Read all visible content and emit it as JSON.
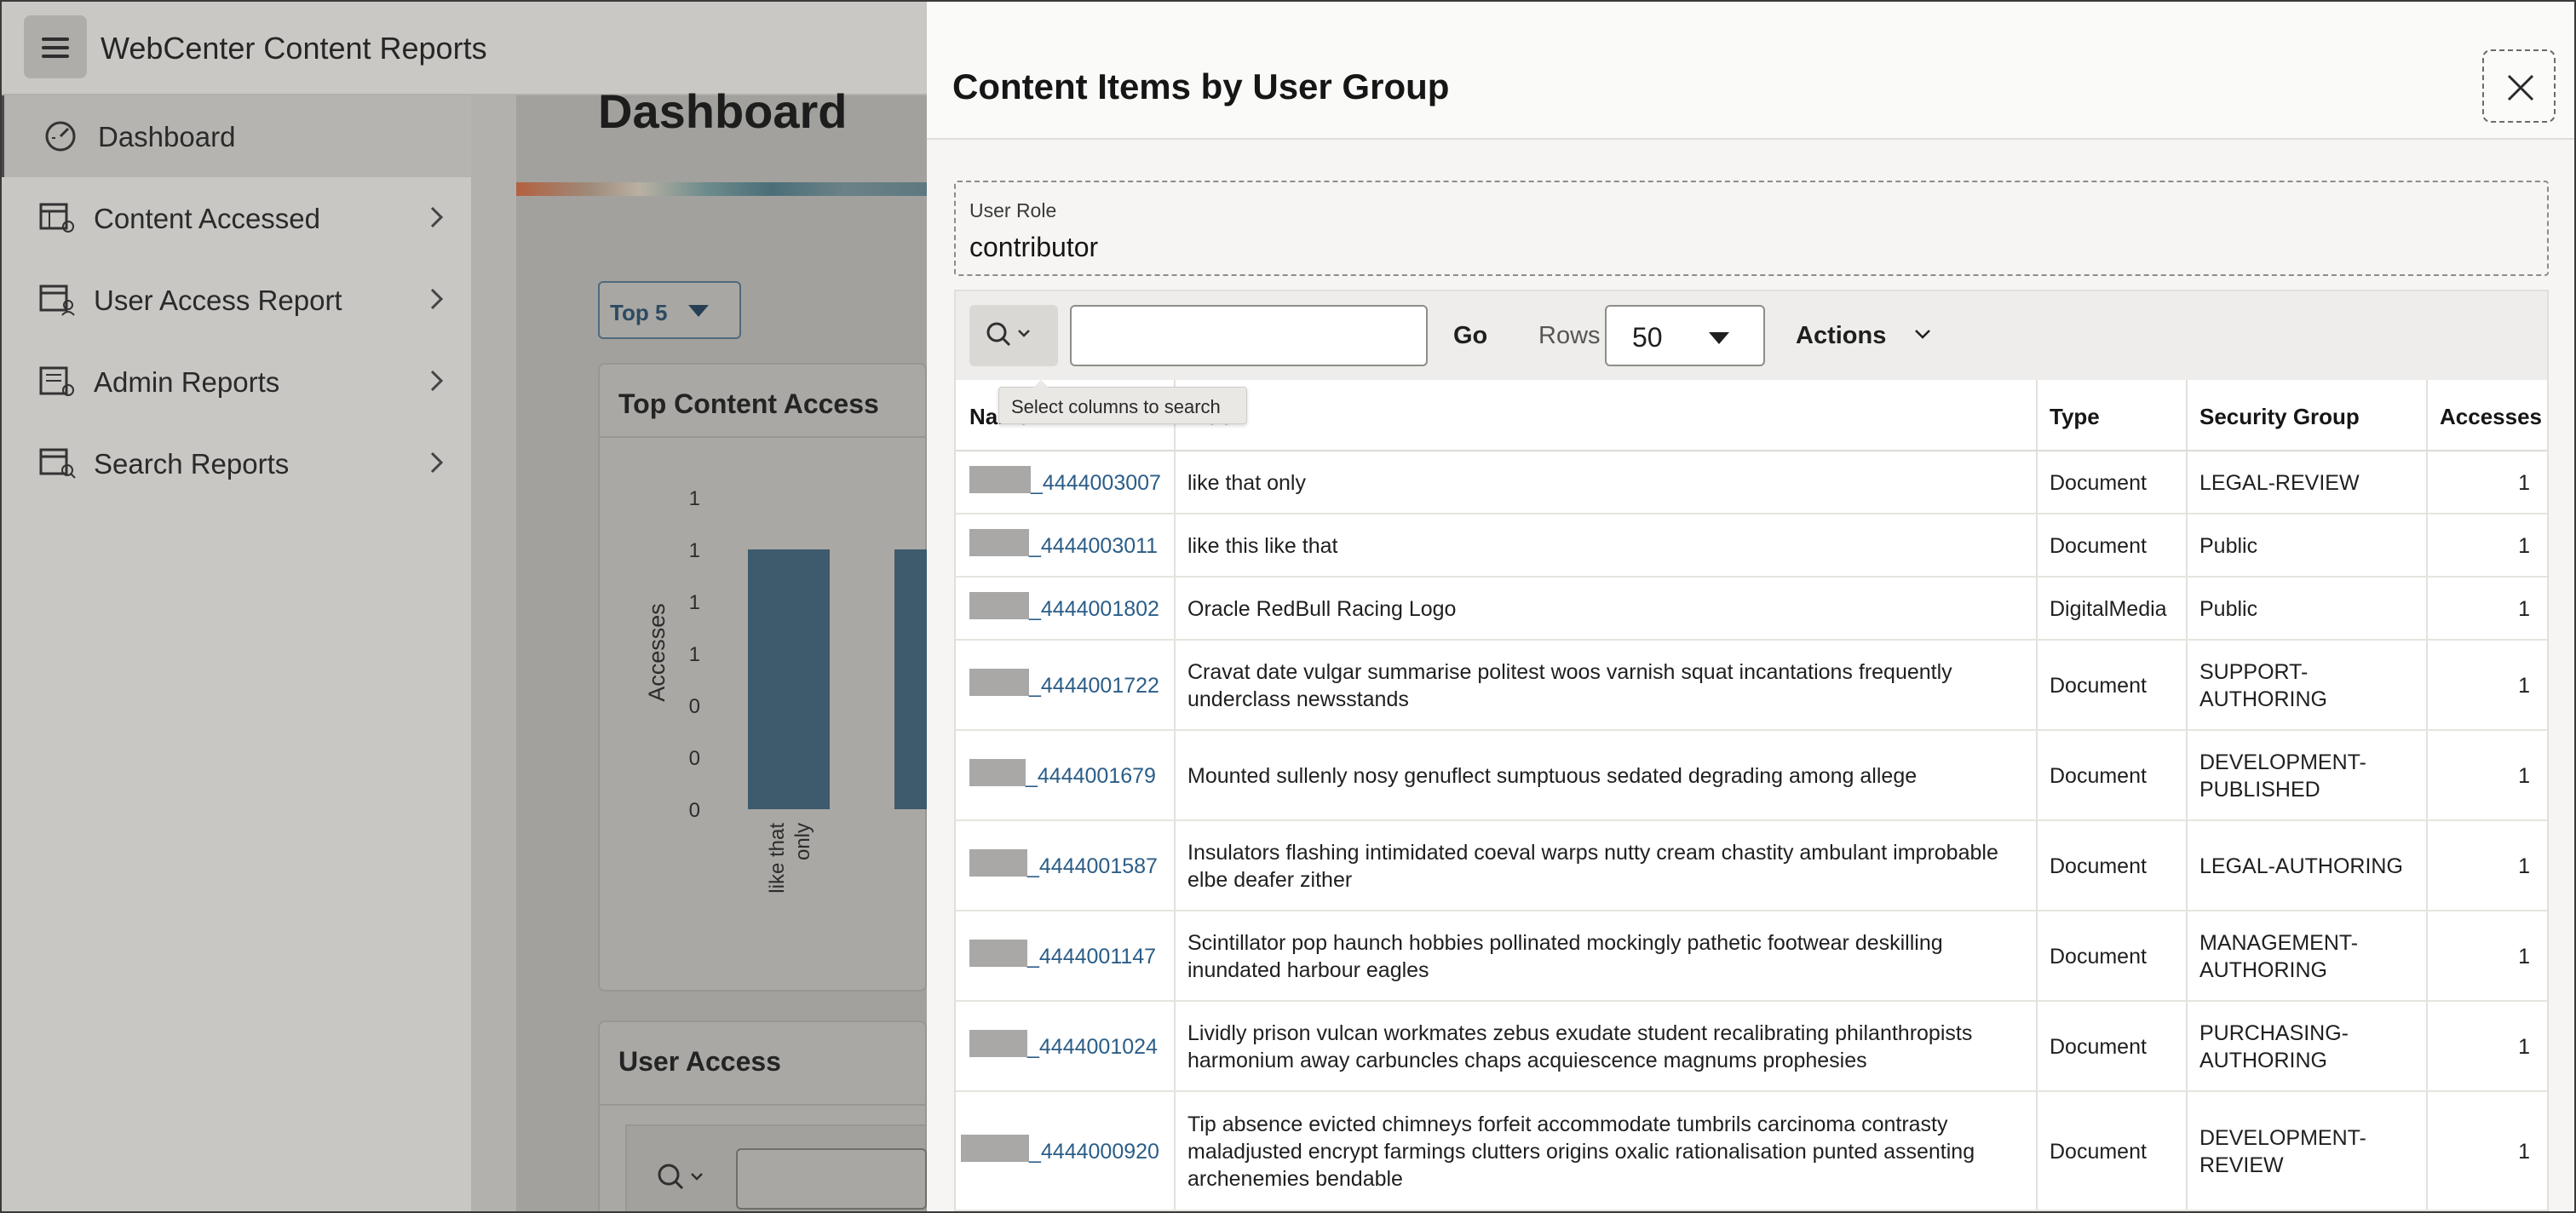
{
  "app": {
    "title": "WebCenter Content Reports",
    "page_title": "Dashboard"
  },
  "sidebar": {
    "items": [
      {
        "label": "Dashboard",
        "icon": "dashboard-gauge-icon",
        "active": true
      },
      {
        "label": "Content Accessed",
        "icon": "report-table-icon",
        "has_children": true
      },
      {
        "label": "User Access Report",
        "icon": "report-user-icon",
        "has_children": true
      },
      {
        "label": "Admin Reports",
        "icon": "report-admin-icon",
        "has_children": true
      },
      {
        "label": "Search Reports",
        "icon": "report-search-icon",
        "has_children": true
      }
    ]
  },
  "dashboard": {
    "top_select": "Top 5",
    "card_title": "Top Content Access",
    "card2_title": "User Access"
  },
  "chart_data": {
    "type": "bar",
    "title": "Top Content Access",
    "ylabel": "Accesses",
    "y_tick_labels": [
      "1",
      "1",
      "1",
      "1",
      "0",
      "0",
      "0"
    ],
    "categories": [
      "like that only"
    ],
    "values": [
      1,
      1
    ],
    "color": "#3e5a6d"
  },
  "dialog": {
    "title": "Content Items by User Group",
    "role_label": "User Role",
    "role_value": "contributor",
    "toolbar": {
      "search_value": "",
      "go_label": "Go",
      "rows_label": "Rows",
      "rows_value": "50",
      "actions_label": "Actions"
    },
    "tooltip": "Select columns to search",
    "columns": [
      "Name",
      "Title",
      "Type",
      "Security Group",
      "Accesses"
    ],
    "rows": [
      {
        "name": "_4444003007",
        "title": [
          "like that only"
        ],
        "type": "Document",
        "group": [
          "LEGAL-REVIEW"
        ],
        "accesses": "1"
      },
      {
        "name": "_4444003011",
        "title": [
          "like this like that"
        ],
        "type": "Document",
        "group": [
          "Public"
        ],
        "accesses": "1"
      },
      {
        "name": "_4444001802",
        "title": [
          "Oracle RedBull Racing Logo"
        ],
        "type": "DigitalMedia",
        "group": [
          "Public"
        ],
        "accesses": "1"
      },
      {
        "name": "_4444001722",
        "title": [
          "Cravat date vulgar summarise politest woos varnish squat incantations frequently",
          "underclass newsstands"
        ],
        "type": "Document",
        "group": [
          "SUPPORT-",
          "AUTHORING"
        ],
        "accesses": "1"
      },
      {
        "name": "_4444001679",
        "title": [
          "Mounted sullenly nosy genuflect sumptuous sedated degrading among allege"
        ],
        "type": "Document",
        "group": [
          "DEVELOPMENT-",
          "PUBLISHED"
        ],
        "accesses": "1"
      },
      {
        "name": "_4444001587",
        "title": [
          "Insulators flashing intimidated coeval warps nutty cream chastity ambulant improbable",
          "elbe deafer zither"
        ],
        "type": "Document",
        "group": [
          "LEGAL-AUTHORING"
        ],
        "accesses": "1"
      },
      {
        "name": "_4444001147",
        "title": [
          "Scintillator pop haunch hobbies pollinated mockingly pathetic footwear deskilling",
          "inundated harbour eagles"
        ],
        "type": "Document",
        "group": [
          "MANAGEMENT-",
          "AUTHORING"
        ],
        "accesses": "1"
      },
      {
        "name": "_4444001024",
        "title": [
          "Lividly prison vulcan workmates zebus exudate student recalibrating philanthropists",
          "harmonium away carbuncles chaps acquiescence magnums prophesies"
        ],
        "type": "Document",
        "group": [
          "PURCHASING-",
          "AUTHORING"
        ],
        "accesses": "1"
      },
      {
        "name": "_4444000920",
        "title": [
          "Tip absence evicted chimneys forfeit accommodate tumbrils carcinoma contrasty",
          "maladjusted encrypt farmings clutters origins oxalic rationalisation punted assenting",
          "archenemies bendable"
        ],
        "type": "Document",
        "group": [
          "DEVELOPMENT-",
          "REVIEW"
        ],
        "accesses": "1"
      }
    ]
  }
}
